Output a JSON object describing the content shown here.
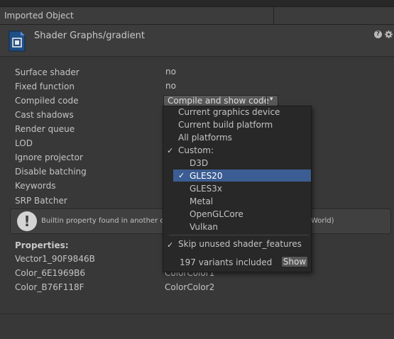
{
  "window": {
    "title": "Imported Object"
  },
  "asset": {
    "title": "Shader Graphs/gradient",
    "help_icon": "question-icon",
    "settings_icon": "gear-icon"
  },
  "properties_rows": [
    {
      "label": "Surface shader",
      "value": "no"
    },
    {
      "label": "Fixed function",
      "value": "no"
    },
    {
      "label": "Compiled code",
      "value": ""
    },
    {
      "label": "Cast shadows",
      "value": ""
    },
    {
      "label": "Render queue",
      "value": ""
    },
    {
      "label": "LOD",
      "value": ""
    },
    {
      "label": "Ignore projector",
      "value": ""
    },
    {
      "label": "Disable batching",
      "value": ""
    },
    {
      "label": "Keywords",
      "value": ""
    },
    {
      "label": "SRP Batcher",
      "value": ""
    }
  ],
  "compile_button": {
    "label": "Compile and show code",
    "arrow": "▾"
  },
  "info": {
    "icon": "warning-icon",
    "text_left": "Builtin property found in another cb",
    "text_right": "World)"
  },
  "shader_properties": {
    "heading": "Properties:",
    "items": [
      {
        "name": "Vector1_90F9846B",
        "value": ""
      },
      {
        "name": "Color_6E1969B6",
        "value": "ColorColor1"
      },
      {
        "name": "Color_B76F118F",
        "value": "ColorColor2"
      }
    ]
  },
  "dropdown": {
    "items": [
      {
        "label": "Current graphics device",
        "checked": false,
        "indent": false,
        "selected": false
      },
      {
        "label": "Current build platform",
        "checked": false,
        "indent": false,
        "selected": false
      },
      {
        "label": "All platforms",
        "checked": false,
        "indent": false,
        "selected": false
      },
      {
        "label": "Custom:",
        "checked": true,
        "indent": false,
        "selected": false
      },
      {
        "label": "D3D",
        "checked": false,
        "indent": true,
        "selected": false
      },
      {
        "label": "GLES20",
        "checked": true,
        "indent": true,
        "selected": true
      },
      {
        "label": "GLES3x",
        "checked": false,
        "indent": true,
        "selected": false
      },
      {
        "label": "Metal",
        "checked": false,
        "indent": true,
        "selected": false
      },
      {
        "label": "OpenGLCore",
        "checked": false,
        "indent": true,
        "selected": false
      },
      {
        "label": "Vulkan",
        "checked": false,
        "indent": true,
        "selected": false
      }
    ],
    "skip_unused": "Skip unused shader_features",
    "variants_text": "197 variants included",
    "show_label": "Show",
    "check_glyph": "✓"
  },
  "colors": {
    "highlight": "#3c5d93",
    "background": "#383838",
    "menu_bg": "#282828"
  }
}
